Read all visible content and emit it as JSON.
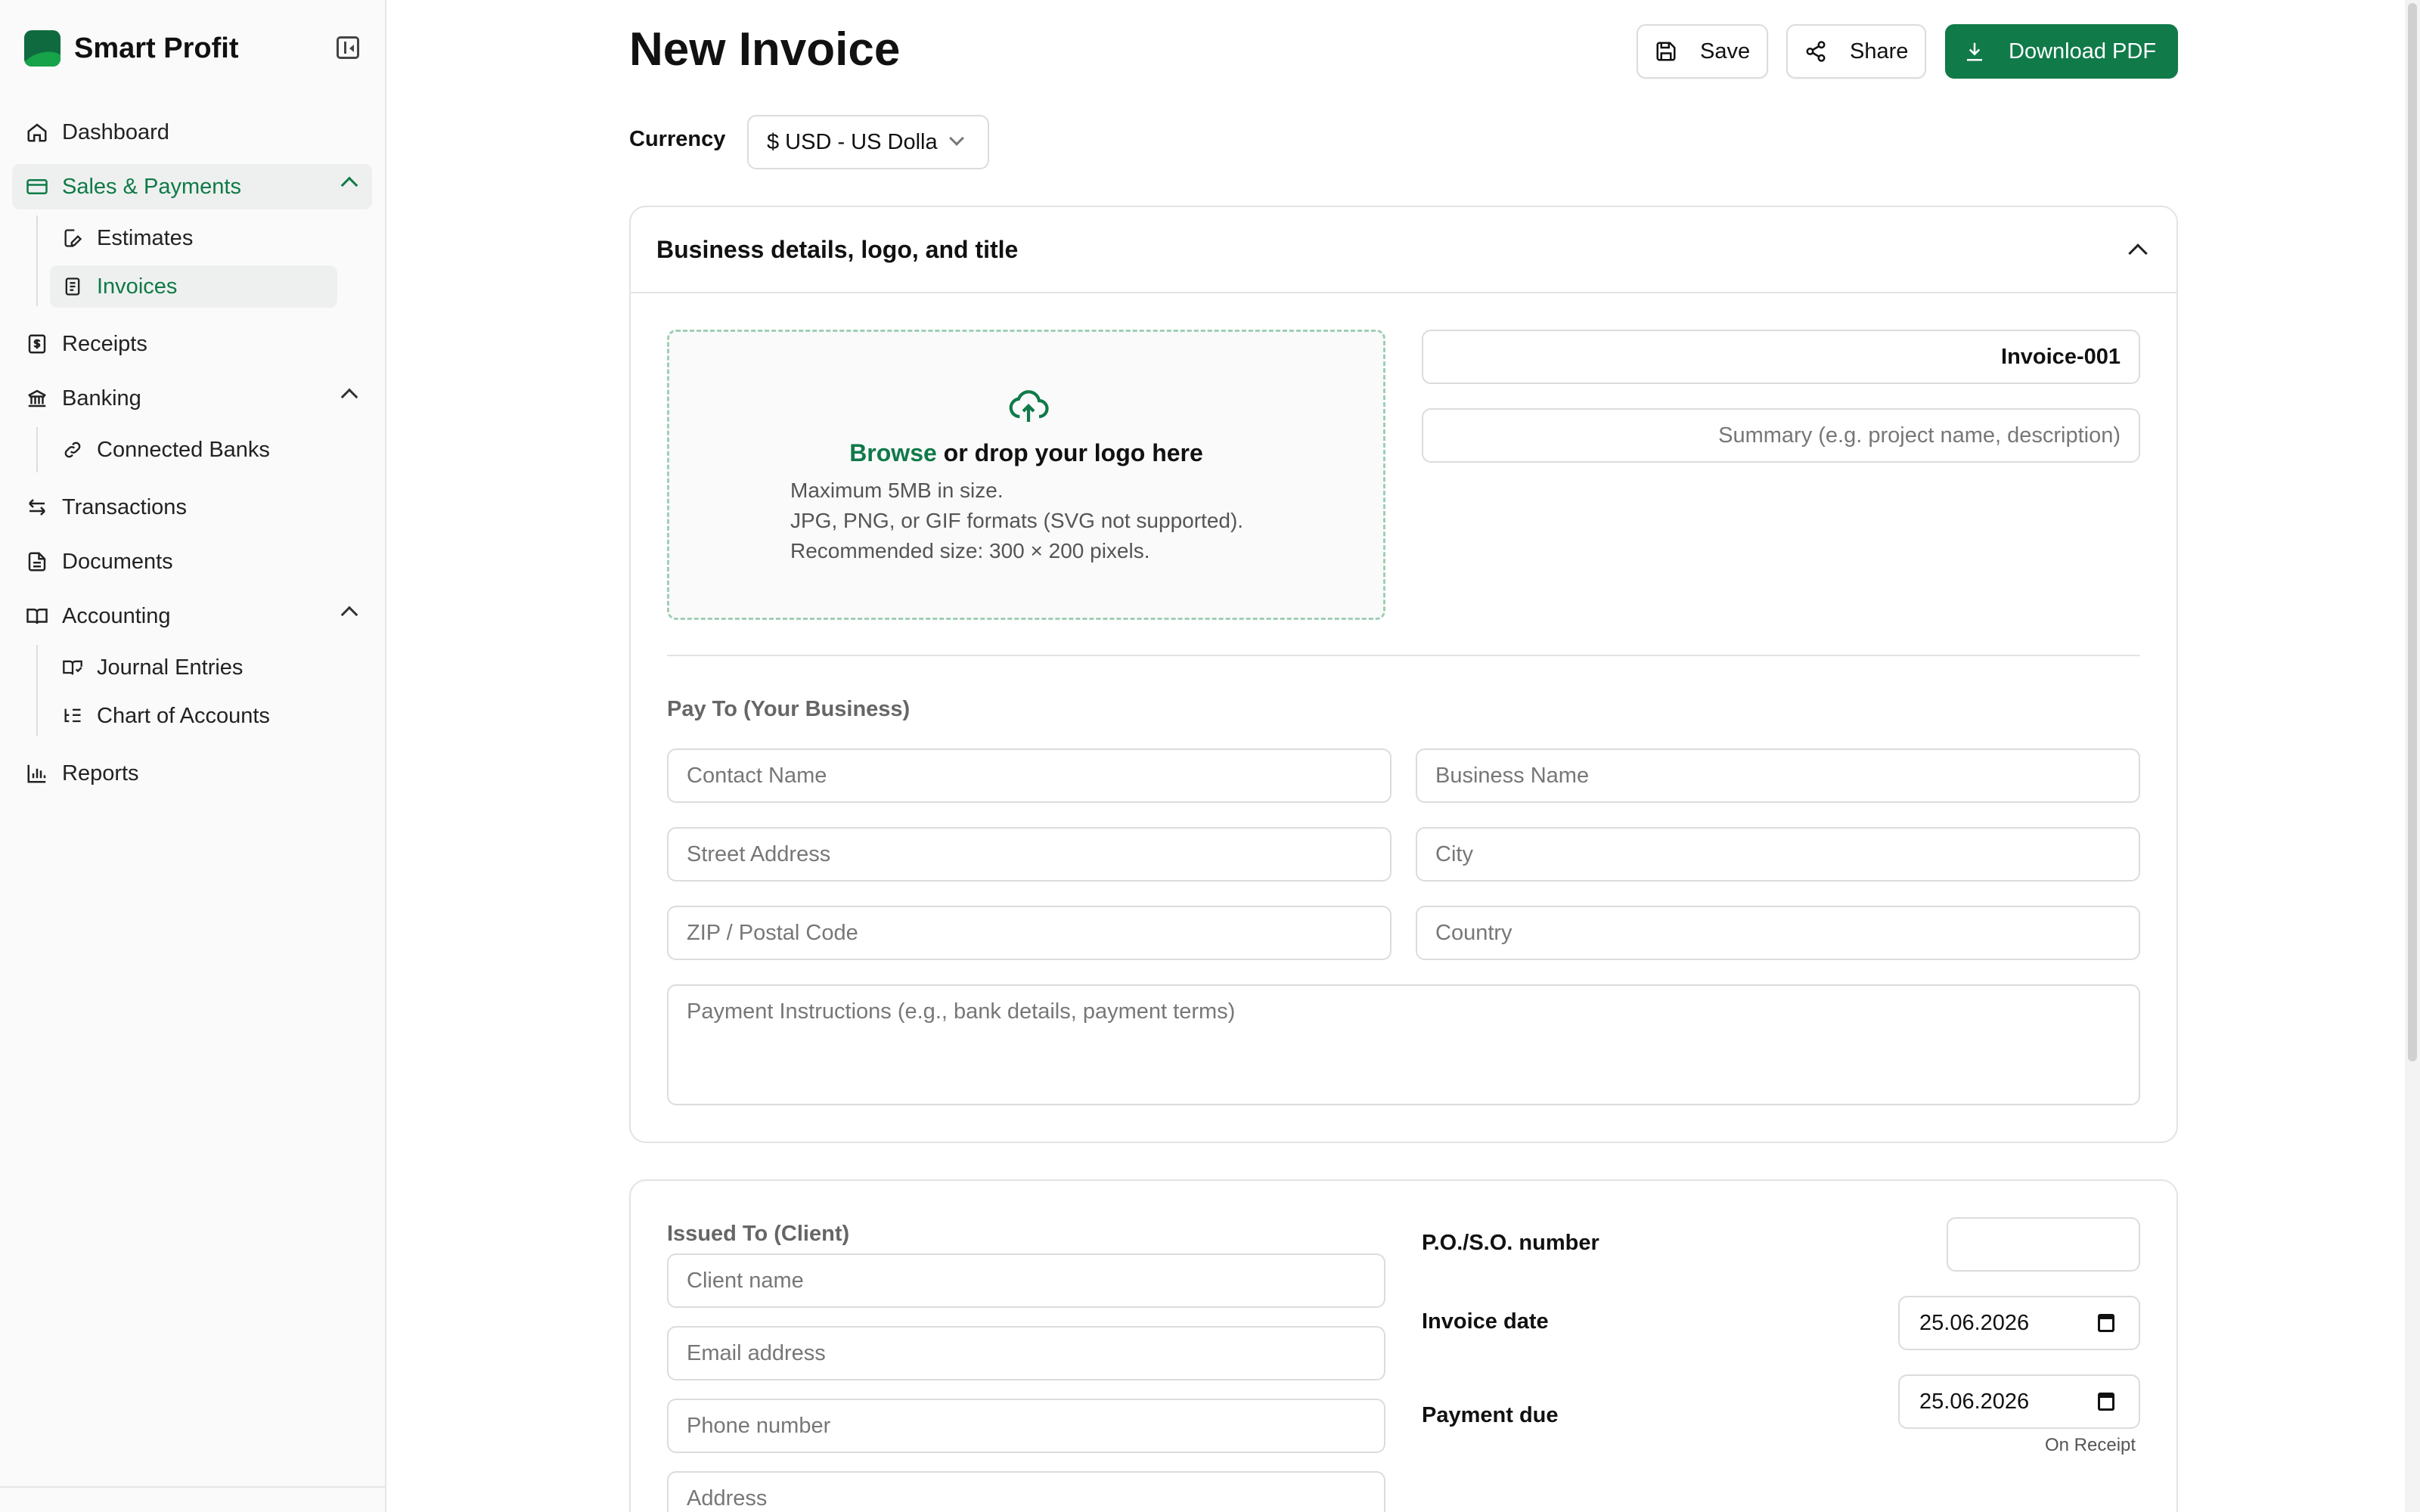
{
  "brand": {
    "name": "Smart Profit"
  },
  "nav": {
    "dashboard": "Dashboard",
    "sales": "Sales & Payments",
    "estimates": "Estimates",
    "invoices": "Invoices",
    "receipts": "Receipts",
    "banking": "Banking",
    "connected_banks": "Connected Banks",
    "transactions": "Transactions",
    "documents": "Documents",
    "accounting": "Accounting",
    "journal_entries": "Journal Entries",
    "chart_of_accounts": "Chart of Accounts",
    "reports": "Reports"
  },
  "header": {
    "title": "New Invoice",
    "save": "Save",
    "share": "Share",
    "download": "Download PDF"
  },
  "currency": {
    "label": "Currency",
    "value": "$ USD - US Dolla"
  },
  "business": {
    "title": "Business details, logo, and title",
    "browse": "Browse",
    "drop_text": " or drop your logo here",
    "hint1": "Maximum 5MB in size.",
    "hint2": "JPG, PNG, or GIF formats (SVG not supported).",
    "hint3": "Recommended size: 300 × 200 pixels.",
    "invoice_number": "Invoice-001",
    "summary_placeholder": "Summary (e.g. project name, description)",
    "pay_to_label": "Pay To (Your Business)",
    "contact_placeholder": "Contact Name",
    "business_placeholder": "Business Name",
    "street_placeholder": "Street Address",
    "city_placeholder": "City",
    "zip_placeholder": "ZIP / Postal Code",
    "country_placeholder": "Country",
    "instructions_placeholder": "Payment Instructions (e.g., bank details, payment terms)"
  },
  "client": {
    "label": "Issued To (Client)",
    "name_placeholder": "Client name",
    "email_placeholder": "Email address",
    "phone_placeholder": "Phone number",
    "address_placeholder": "Address",
    "po_label": "P.O./S.O. number",
    "invoice_date_label": "Invoice date",
    "invoice_date": "25.06.2026",
    "payment_due_label": "Payment due",
    "payment_due": "25.06.2026",
    "due_note": "On Receipt"
  },
  "colors": {
    "accent": "#107a49",
    "border": "#dcdcdc"
  }
}
